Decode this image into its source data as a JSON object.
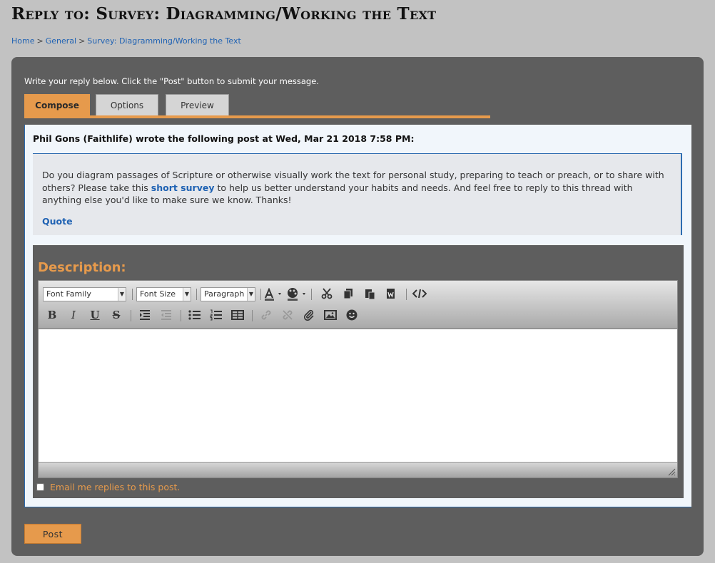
{
  "page": {
    "title": "Reply to: Survey: Diagramming/Working the Text"
  },
  "breadcrumb": {
    "items": [
      "Home",
      "General",
      "Survey: Diagramming/Working the Text"
    ],
    "separator": ">"
  },
  "form": {
    "instructions": "Write your reply below. Click the \"Post\" button to submit your message.",
    "tabs": [
      {
        "label": "Compose",
        "active": true
      },
      {
        "label": "Options",
        "active": false
      },
      {
        "label": "Preview",
        "active": false
      }
    ]
  },
  "quote": {
    "header": "Phil Gons (Faithlife) wrote the following post at Wed, Mar 21 2018 7:58 PM:",
    "text_before": "Do you diagram passages of Scripture or otherwise visually work the text for personal study, preparing to teach or preach, or to share with others? Please take this ",
    "link_text": "short survey",
    "text_after": " to help us better understand your habits and needs. And feel free to reply to this thread with anything else you'd like to make sure we know. Thanks!",
    "quote_link": "Quote"
  },
  "editor": {
    "label": "Description:",
    "font_family": "Font Family",
    "font_size": "Font Size",
    "block_format": "Paragraph",
    "body_text": ""
  },
  "options": {
    "email_label": "Email me replies to this post.",
    "email_checked": false
  },
  "actions": {
    "post_label": "Post"
  },
  "colors": {
    "accent": "#e69a4c",
    "panel": "#5e5e5e",
    "link": "#1f62b3",
    "background": "#c2c2c2"
  },
  "icons": {
    "row1": [
      "text-color-icon",
      "background-color-icon",
      "cut-icon",
      "copy-icon",
      "paste-icon",
      "paste-from-word-icon",
      "source-code-icon"
    ],
    "row2": [
      "bold-icon",
      "italic-icon",
      "underline-icon",
      "strikethrough-icon",
      "indent-icon",
      "outdent-icon",
      "bullet-list-icon",
      "numbered-list-icon",
      "table-icon",
      "link-icon",
      "unlink-icon",
      "attachment-icon",
      "image-icon",
      "emoticon-icon"
    ]
  }
}
